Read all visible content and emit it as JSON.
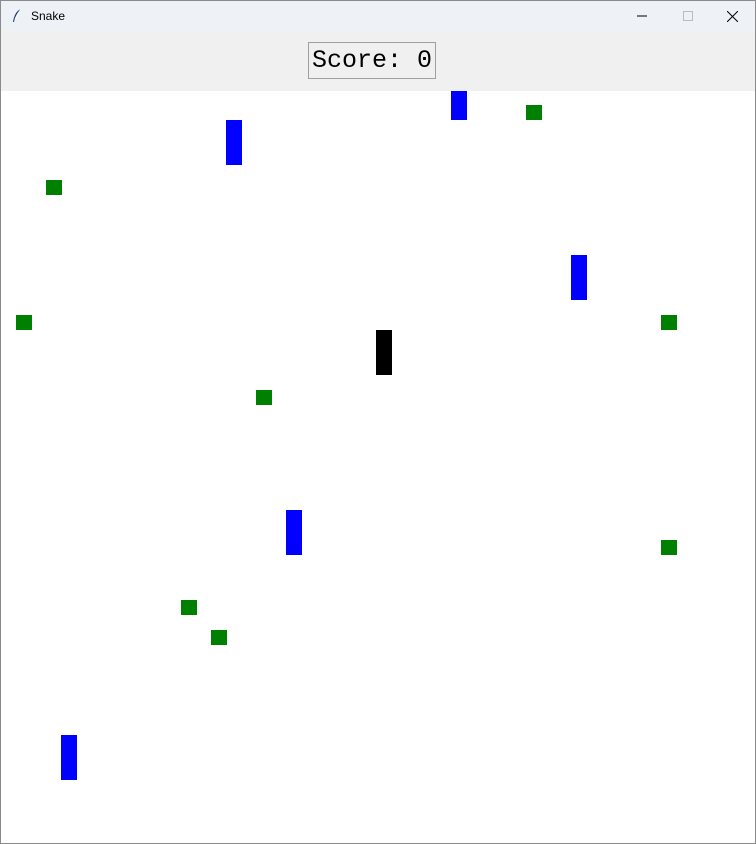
{
  "window": {
    "title": "Snake",
    "icon": "feather-icon",
    "controls": [
      "minimize-icon",
      "maximize-icon",
      "close-icon"
    ]
  },
  "score": {
    "label": "Score:",
    "value": "0"
  },
  "colors": {
    "food": "#008000",
    "obstacle": "#0000ff",
    "snake": "#000000",
    "scorebar": "#f0f0f0",
    "field": "#ffffff"
  }
}
